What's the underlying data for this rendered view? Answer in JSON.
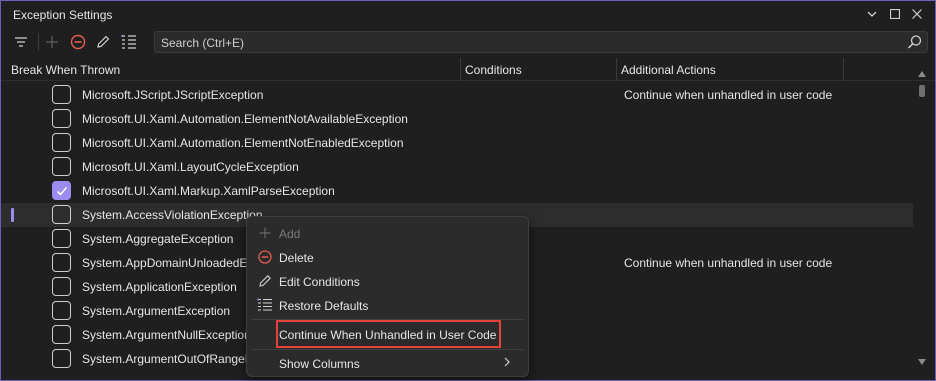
{
  "window": {
    "title": "Exception Settings",
    "controls": {
      "dropdown": "chevron-down",
      "maximize": "maximize",
      "close": "close"
    }
  },
  "toolbar": {
    "icons": [
      "filter-icon",
      "add-icon",
      "delete-icon",
      "edit-icon",
      "restore-defaults-icon"
    ],
    "search": {
      "placeholder": "Search (Ctrl+E)",
      "value": ""
    }
  },
  "columns": {
    "break_when_thrown": "Break When Thrown",
    "conditions": "Conditions",
    "additional_actions": "Additional Actions"
  },
  "rows": [
    {
      "label": "Microsoft.JScript.JScriptException",
      "checked": false,
      "action": "Continue when unhandled in user code"
    },
    {
      "label": "Microsoft.UI.Xaml.Automation.ElementNotAvailableException",
      "checked": false,
      "action": ""
    },
    {
      "label": "Microsoft.UI.Xaml.Automation.ElementNotEnabledException",
      "checked": false,
      "action": ""
    },
    {
      "label": "Microsoft.UI.Xaml.LayoutCycleException",
      "checked": false,
      "action": ""
    },
    {
      "label": "Microsoft.UI.Xaml.Markup.XamlParseException",
      "checked": true,
      "action": ""
    },
    {
      "label": "System.AccessViolationException",
      "checked": false,
      "action": "",
      "selected": true
    },
    {
      "label": "System.AggregateException",
      "checked": false,
      "action": ""
    },
    {
      "label": "System.AppDomainUnloadedException",
      "checked": false,
      "action": "Continue when unhandled in user code"
    },
    {
      "label": "System.ApplicationException",
      "checked": false,
      "action": ""
    },
    {
      "label": "System.ArgumentException",
      "checked": false,
      "action": ""
    },
    {
      "label": "System.ArgumentNullException",
      "checked": false,
      "action": ""
    },
    {
      "label": "System.ArgumentOutOfRangeException",
      "checked": false,
      "action": ""
    }
  ],
  "context_menu": {
    "items": [
      {
        "label": "Add",
        "icon": "add-icon",
        "disabled": true
      },
      {
        "label": "Delete",
        "icon": "delete-icon",
        "disabled": false
      },
      {
        "label": "Edit Conditions",
        "icon": "edit-icon",
        "disabled": false
      },
      {
        "label": "Restore Defaults",
        "icon": "restore-defaults-icon",
        "disabled": false
      },
      {
        "label": "Continue When Unhandled in User Code",
        "icon": "",
        "disabled": false,
        "highlighted": true
      },
      {
        "label": "Show Columns",
        "icon": "",
        "disabled": false,
        "submenu": true
      }
    ]
  },
  "colors": {
    "accent": "#9b8cf0",
    "highlight_border": "#e8413c",
    "delete_red": "#e0604f"
  }
}
